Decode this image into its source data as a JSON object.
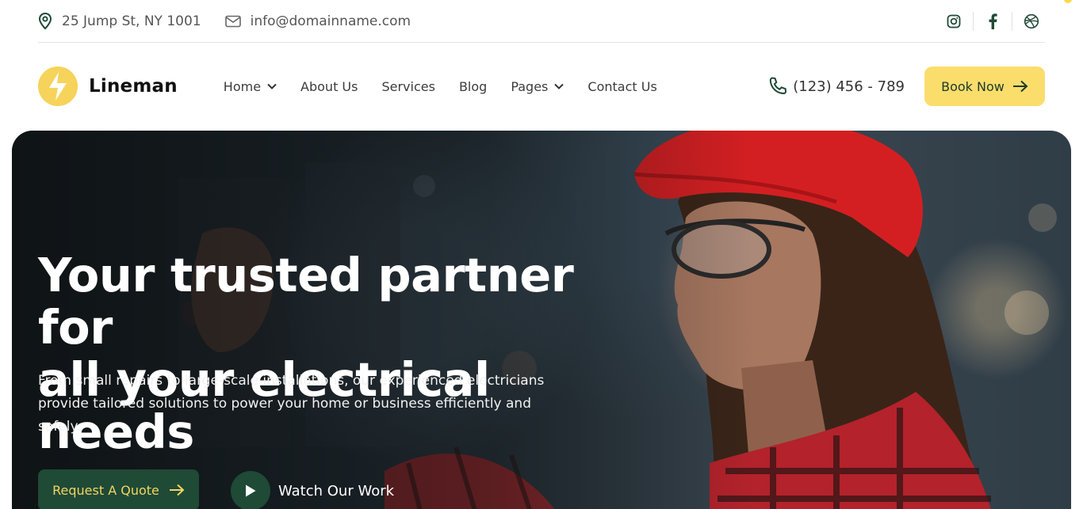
{
  "topbar": {
    "address": "25 Jump St, NY 1001",
    "email": "info@domainname.com",
    "socials": [
      "instagram-icon",
      "facebook-icon",
      "dribbble-icon"
    ]
  },
  "nav": {
    "brand": "Lineman",
    "menu": [
      {
        "label": "Home",
        "dropdown": true
      },
      {
        "label": "About Us",
        "dropdown": false
      },
      {
        "label": "Services",
        "dropdown": false
      },
      {
        "label": "Blog",
        "dropdown": false
      },
      {
        "label": "Pages",
        "dropdown": true
      },
      {
        "label": "Contact Us",
        "dropdown": false
      }
    ],
    "phone": "(123) 456 - 789",
    "cta": "Book Now"
  },
  "hero": {
    "headline_line1": "Your trusted partner for",
    "headline_line2": "all your electrical needs",
    "subtext": "From small repairs to large-scale installations, our experienced electricians provide tailored solutions to power your home or business efficiently and safely.",
    "primary_cta": "Request A Quote",
    "secondary_cta": "Watch Our Work"
  },
  "colors": {
    "accent_yellow": "#fbdd6c",
    "dark_green": "#1f4a36",
    "logo_yellow": "#f6d35a"
  }
}
